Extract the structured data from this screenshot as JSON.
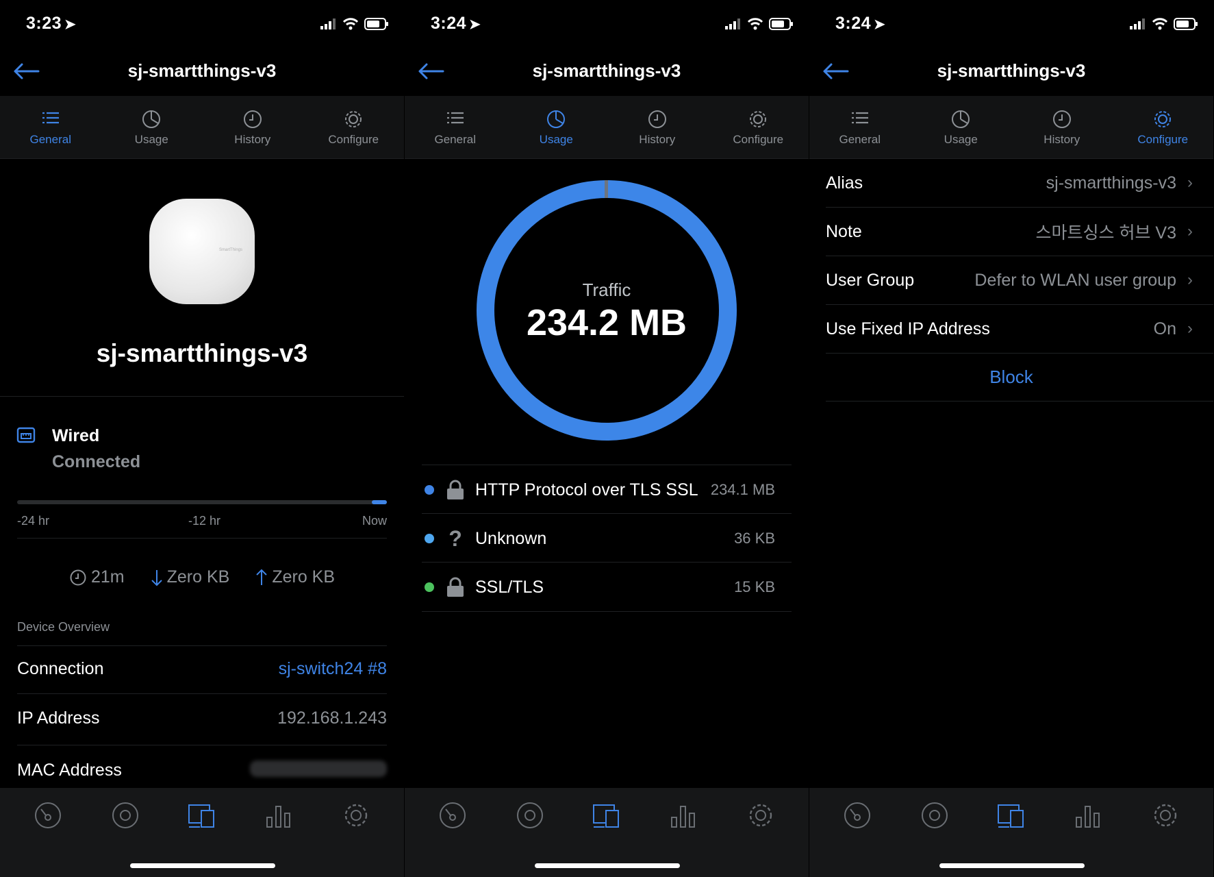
{
  "panels": [
    {
      "time": "3:23",
      "title": "sj-smartthings-v3",
      "tabs": [
        "General",
        "Usage",
        "History",
        "Configure"
      ],
      "active_tab": 0
    },
    {
      "time": "3:24",
      "title": "sj-smartthings-v3",
      "tabs": [
        "General",
        "Usage",
        "History",
        "Configure"
      ],
      "active_tab": 1
    },
    {
      "time": "3:24",
      "title": "sj-smartthings-v3",
      "tabs": [
        "General",
        "Usage",
        "History",
        "Configure"
      ],
      "active_tab": 3
    }
  ],
  "general": {
    "device_name": "sj-smartthings-v3",
    "connection_type": "Wired",
    "connection_status": "Connected",
    "uptime_fraction": 0.04,
    "timeline": [
      "-24 hr",
      "-12 hr",
      "Now"
    ],
    "uptime": "21m",
    "download": "Zero KB",
    "upload": "Zero KB",
    "section": "Device Overview",
    "details": [
      {
        "label": "Connection",
        "value": "sj-switch24 #8"
      },
      {
        "label": "IP Address",
        "value": "192.168.1.243"
      },
      {
        "label": "MAC Address",
        "value": ""
      }
    ]
  },
  "usage": {
    "traffic_label": "Traffic",
    "traffic_total": "234.2 MB",
    "protocols": [
      {
        "name": "HTTP Protocol over TLS SSL",
        "value": "234.1 MB",
        "color": "#3f84e6",
        "icon": "lock-icon"
      },
      {
        "name": "Unknown",
        "value": "36 KB",
        "color": "#4ea7f0",
        "icon": "question-icon"
      },
      {
        "name": "SSL/TLS",
        "value": "15 KB",
        "color": "#4cc25e",
        "icon": "lock-icon"
      }
    ]
  },
  "configure": {
    "rows": [
      {
        "label": "Alias",
        "value": "sj-smartthings-v3"
      },
      {
        "label": "Note",
        "value": "스마트싱스 허브 V3"
      },
      {
        "label": "User Group",
        "value": "Defer to WLAN user group"
      },
      {
        "label": "Use Fixed IP Address",
        "value": "On"
      }
    ],
    "block_label": "Block"
  },
  "bottom_nav": [
    "dashboard-icon",
    "clients-ring-icon",
    "devices-icon",
    "stats-icon",
    "settings-icon"
  ],
  "colors": {
    "accent": "#3f84e6",
    "background": "#000000",
    "muted": "#8d9196"
  }
}
